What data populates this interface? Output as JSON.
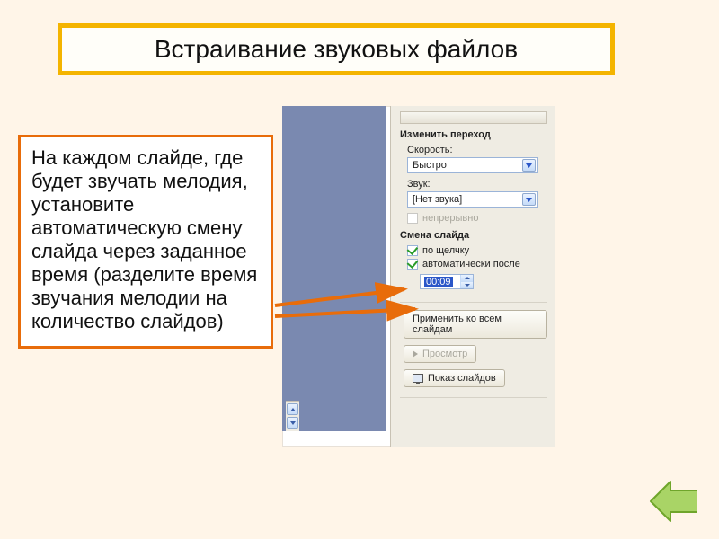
{
  "title": "Встраивание звуковых файлов",
  "instruction": "На каждом слайде, где будет звучать мелодия, установите автоматическую смену слайда через заданное время (разделите время звучания мелодии на количество слайдов)",
  "panel": {
    "section_transition": "Изменить переход",
    "speed_label": "Скорость:",
    "speed_value": "Быстро",
    "sound_label": "Звук:",
    "sound_value": "[Нет звука]",
    "loop_label": "непрерывно",
    "section_advance": "Смена слайда",
    "on_click_label": "по щелчку",
    "auto_after_label": "автоматически после",
    "auto_time": "00:09",
    "apply_all": "Применить ко всем слайдам",
    "preview": "Просмотр",
    "slideshow": "Показ слайдов"
  },
  "colors": {
    "accent_orange": "#e86c0a",
    "accent_gold": "#f4b400",
    "arrow_green": "#8bc34a"
  }
}
